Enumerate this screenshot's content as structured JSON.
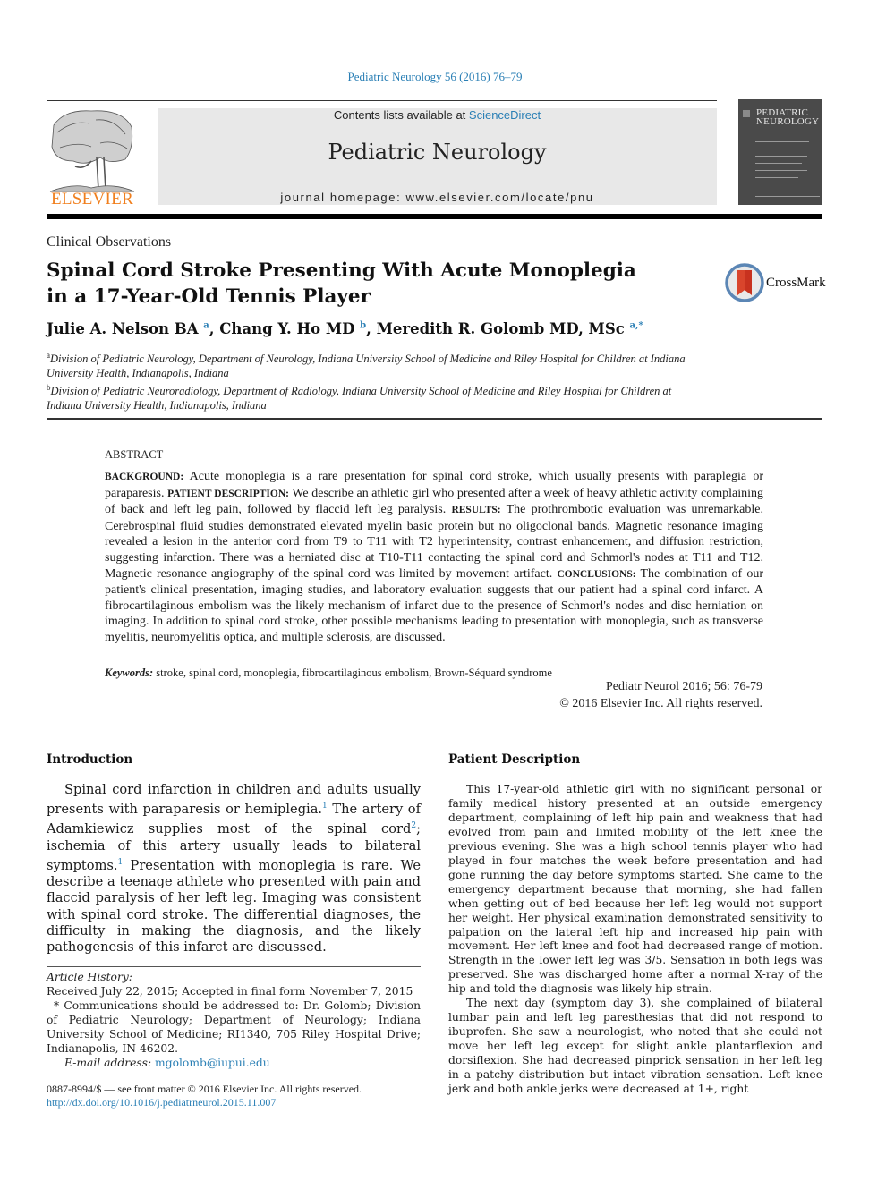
{
  "header": {
    "citation": "Pediatric Neurology 56 (2016) 76–79",
    "contents_prefix": "Contents lists available at ",
    "contents_link": "ScienceDirect",
    "journal_title": "Pediatric Neurology",
    "homepage": "journal homepage: www.elsevier.com/locate/pnu",
    "publisher_logo_text": "ELSEVIER",
    "cover_title_line1": "PEDIATRIC",
    "cover_title_line2": "NEUROLOGY",
    "brand_color": "#f07f1e",
    "link_color": "#2a7fb5"
  },
  "article": {
    "section": "Clinical Observations",
    "title_line1": "Spinal Cord Stroke Presenting With Acute Monoplegia",
    "title_line2": "in a 17-Year-Old Tennis Player",
    "crossmark": "CrossMark",
    "authors": [
      {
        "name": "Julie A. Nelson BA",
        "sup": "a"
      },
      {
        "name": "Chang Y. Ho MD",
        "sup": "b"
      },
      {
        "name": "Meredith R. Golomb MD, MSc",
        "sup": "a,*"
      }
    ],
    "affiliations": [
      {
        "label": "a",
        "text": "Division of Pediatric Neurology, Department of Neurology, Indiana University School of Medicine and Riley Hospital for Children at Indiana University Health, Indianapolis, Indiana"
      },
      {
        "label": "b",
        "text": "Division of Pediatric Neuroradiology, Department of Radiology, Indiana University School of Medicine and Riley Hospital for Children at Indiana University Health, Indianapolis, Indiana"
      }
    ]
  },
  "abstract": {
    "label": "ABSTRACT",
    "sections": [
      {
        "head": "BACKGROUND:",
        "text": " Acute monoplegia is a rare presentation for spinal cord stroke, which usually presents with paraplegia or paraparesis. "
      },
      {
        "head": "PATIENT DESCRIPTION:",
        "text": " We describe an athletic girl who presented after a week of heavy athletic activity complaining of back and left leg pain, followed by flaccid left leg paralysis. "
      },
      {
        "head": "RESULTS:",
        "text": " The prothrombotic evaluation was unremarkable. Cerebrospinal fluid studies demonstrated elevated myelin basic protein but no oligoclonal bands. Magnetic resonance imaging revealed a lesion in the anterior cord from T9 to T11 with T2 hyperintensity, contrast enhancement, and diffusion restriction, suggesting infarction. There was a herniated disc at T10-T11 contacting the spinal cord and Schmorl's nodes at T11 and T12. Magnetic resonance angiography of the spinal cord was limited by movement artifact. "
      },
      {
        "head": "CONCLUSIONS:",
        "text": " The combination of our patient's clinical presentation, imaging studies, and laboratory evaluation suggests that our patient had a spinal cord infarct. A fibrocartilaginous embolism was the likely mechanism of infarct due to the presence of Schmorl's nodes and disc herniation on imaging. In addition to spinal cord stroke, other possible mechanisms leading to presentation with monoplegia, such as transverse myelitis, neuromyelitis optica, and multiple sclerosis, are discussed."
      }
    ],
    "keywords_label": "Keywords:",
    "keywords": " stroke, spinal cord, monoplegia, fibrocartilaginous embolism, Brown-Séquard syndrome",
    "cite": "Pediatr Neurol 2016; 56: 76-79",
    "copyright": "© 2016 Elsevier Inc. All rights reserved."
  },
  "introduction": {
    "heading": "Introduction",
    "parts": [
      "Spinal cord infarction in children and adults usually presents with paraparesis or hemiplegia.",
      "1",
      " The artery of Adamkiewicz supplies most of the spinal cord",
      "2",
      "; ischemia of this artery usually leads to bilateral symptoms.",
      "1",
      " Presentation with monoplegia is rare. We describe a teenage athlete who presented with pain and flaccid paralysis of her left leg. Imaging was consistent with spinal cord stroke. The differential diagnoses, the difficulty in making the diagnosis, and the likely pathogenesis of this infarct are discussed."
    ]
  },
  "article_info": {
    "history_label": "Article History:",
    "history": "Received July 22, 2015; Accepted in final form November 7, 2015",
    "correspondence": "* Communications should be addressed to: Dr. Golomb; Division of Pediatric Neurology; Department of Neurology; Indiana University School of Medicine; RI1340, 705 Riley Hospital Drive; Indianapolis, IN 46202.",
    "email_label": "E-mail address:",
    "email": "mgolomb@iupui.edu",
    "issn_line": "0887-8994/$ — see front matter © 2016 Elsevier Inc. All rights reserved.",
    "doi": "http://dx.doi.org/10.1016/j.pediatrneurol.2015.11.007"
  },
  "patient_description": {
    "heading": "Patient Description",
    "paragraphs": [
      "This 17-year-old athletic girl with no significant personal or family medical history presented at an outside emergency department, complaining of left hip pain and weakness that had evolved from pain and limited mobility of the left knee the previous evening. She was a high school tennis player who had played in four matches the week before presentation and had gone running the day before symptoms started. She came to the emergency department because that morning, she had fallen when getting out of bed because her left leg would not support her weight. Her physical examination demonstrated sensitivity to palpation on the lateral left hip and increased hip pain with movement. Her left knee and foot had decreased range of motion. Strength in the lower left leg was 3/5. Sensation in both legs was preserved. She was discharged home after a normal X-ray of the hip and told the diagnosis was likely hip strain.",
      "The next day (symptom day 3), she complained of bilateral lumbar pain and left leg paresthesias that did not respond to ibuprofen. She saw a neurologist, who noted that she could not move her left leg except for slight ankle plantarflexion and dorsiflexion. She had decreased pinprick sensation in her left leg in a patchy distribution but intact vibration sensation. Left knee jerk and both ankle jerks were decreased at 1+, right"
    ]
  }
}
